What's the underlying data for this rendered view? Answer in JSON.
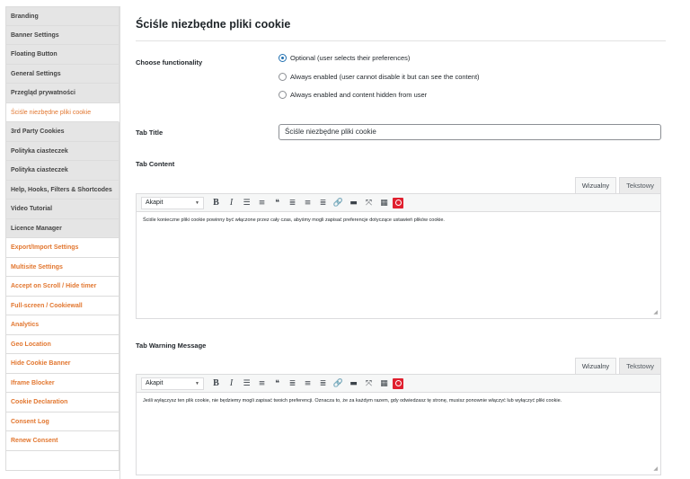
{
  "sidebar": {
    "items": [
      {
        "label": "Branding",
        "style": "grey"
      },
      {
        "label": "Banner Settings",
        "style": "grey"
      },
      {
        "label": "Floating Button",
        "style": "grey"
      },
      {
        "label": "General Settings",
        "style": "grey"
      },
      {
        "label": "Przegląd prywatności",
        "style": "grey"
      },
      {
        "label": "Ściśle niezbędne pliki cookie",
        "style": "active"
      },
      {
        "label": "3rd Party Cookies",
        "style": "grey"
      },
      {
        "label": "Polityka ciasteczek",
        "style": "grey"
      },
      {
        "label": "Polityka ciasteczek",
        "style": "grey"
      },
      {
        "label": "Help, Hooks, Filters & Shortcodes",
        "style": "grey"
      },
      {
        "label": "Video Tutorial",
        "style": "grey"
      },
      {
        "label": "Licence Manager",
        "style": "grey"
      },
      {
        "label": "Export/Import Settings",
        "style": "orange"
      },
      {
        "label": "Multisite Settings",
        "style": "orange"
      },
      {
        "label": "Accept on Scroll / Hide timer",
        "style": "orange"
      },
      {
        "label": "Full-screen / Cookiewall",
        "style": "orange"
      },
      {
        "label": "Analytics",
        "style": "orange"
      },
      {
        "label": "Geo Location",
        "style": "orange"
      },
      {
        "label": "Hide Cookie Banner",
        "style": "orange"
      },
      {
        "label": "Iframe Blocker",
        "style": "orange"
      },
      {
        "label": "Cookie Declaration",
        "style": "orange"
      },
      {
        "label": "Consent Log",
        "style": "orange"
      },
      {
        "label": "Renew Consent",
        "style": "orange"
      }
    ]
  },
  "page": {
    "title": "Ściśle niezbędne pliki cookie"
  },
  "functionality": {
    "label": "Choose functionality",
    "options": [
      {
        "label": "Optional (user selects their preferences)",
        "checked": true
      },
      {
        "label": "Always enabled (user cannot disable it but can see the content)",
        "checked": false
      },
      {
        "label": "Always enabled and content hidden from user",
        "checked": false
      }
    ]
  },
  "tab_title": {
    "label": "Tab Title",
    "value": "Ściśle niezbędne pliki cookie"
  },
  "tab_content": {
    "label": "Tab Content",
    "visual_tab": "Wizualny",
    "text_tab": "Tekstowy",
    "format": "Akapit",
    "body": "Ściśle konieczne pliki cookie powinny być włączone przez cały czas, abyśmy mogli zapisać preferencje dotyczące ustawień plików cookie."
  },
  "tab_warning": {
    "label": "Tab Warning Message",
    "visual_tab": "Wizualny",
    "text_tab": "Tekstowy",
    "format": "Akapit",
    "body": "Jeśli wyłączysz ten plik cookie, nie będziemy mogli zapisać twoich preferencji. Oznacza to, że za każdym razem, gdy odwiedzasz tę stronę, musisz ponownie włączyć lub wyłączyć pliki cookie."
  },
  "toolbar_icons": [
    "bold-icon",
    "italic-icon",
    "bullet-list-icon",
    "numbered-list-icon",
    "blockquote-icon",
    "align-left-icon",
    "align-center-icon",
    "align-right-icon",
    "link-icon",
    "read-more-icon",
    "fullscreen-icon",
    "toolbar-toggle-icon",
    "plugin-icon"
  ],
  "colors": {
    "accent_orange": "#e27730",
    "radio_blue": "#2271b1",
    "plugin_red": "#e0202f"
  }
}
